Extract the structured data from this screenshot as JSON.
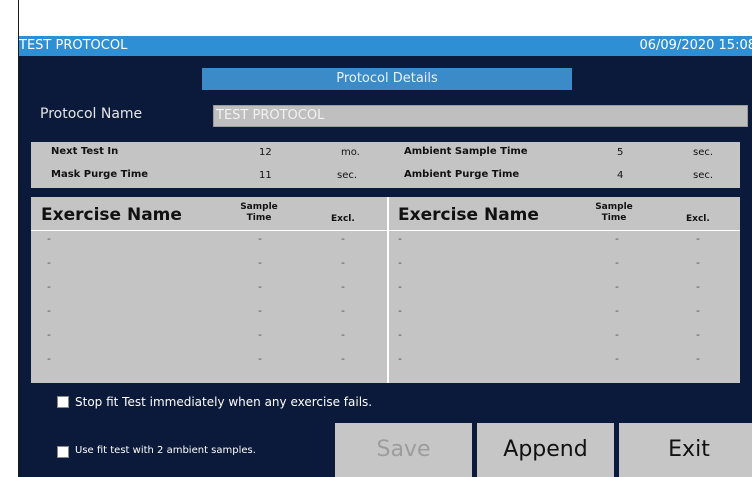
{
  "titlebar": {
    "title": "TEST PROTOCOL",
    "datetime": "06/09/2020 15:08"
  },
  "section_header": "Protocol Details",
  "protocol_name": {
    "label": "Protocol Name",
    "value": "TEST PROTOCOL"
  },
  "params": {
    "next_test_label": "Next Test In",
    "next_test_value": "12",
    "next_test_unit": "mo.",
    "mask_purge_label": "Mask Purge Time",
    "mask_purge_value": "11",
    "mask_purge_unit": "sec.",
    "ambient_sample_label": "Ambient Sample Time",
    "ambient_sample_value": "5",
    "ambient_sample_unit": "sec.",
    "ambient_purge_label": "Ambient Purge Time",
    "ambient_purge_value": "4",
    "ambient_purge_unit": "sec."
  },
  "exercise_table": {
    "col_name": "Exercise Name",
    "col_sample_1": "Sample",
    "col_sample_2": "Time",
    "col_excl": "Excl.",
    "rows": [
      {
        "name": "-",
        "sample": "-",
        "excl": "-"
      },
      {
        "name": "-",
        "sample": "-",
        "excl": "-"
      },
      {
        "name": "-",
        "sample": "-",
        "excl": "-"
      },
      {
        "name": "-",
        "sample": "-",
        "excl": "-"
      },
      {
        "name": "-",
        "sample": "-",
        "excl": "-"
      },
      {
        "name": "-",
        "sample": "-",
        "excl": "-"
      },
      {
        "name": "-",
        "sample": "-",
        "excl": "-"
      },
      {
        "name": "-",
        "sample": "-",
        "excl": "-"
      },
      {
        "name": "-",
        "sample": "-",
        "excl": "-"
      },
      {
        "name": "-",
        "sample": "-",
        "excl": "-"
      },
      {
        "name": "-",
        "sample": "-",
        "excl": "-"
      },
      {
        "name": "-",
        "sample": "-",
        "excl": "-"
      }
    ]
  },
  "options": {
    "stop_on_fail_label": "Stop fit Test immediately when any exercise fails.",
    "two_ambient_label": "Use fit test with 2 ambient samples."
  },
  "buttons": {
    "save": "Save",
    "append": "Append",
    "exit": "Exit"
  }
}
